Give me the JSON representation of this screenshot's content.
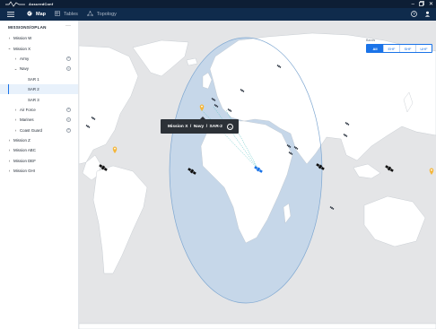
{
  "app": {
    "title": "AssuredConf"
  },
  "nav": {
    "tabs": [
      {
        "label": "Map",
        "icon": "globe-icon",
        "active": true
      },
      {
        "label": "Tables",
        "icon": "table-icon",
        "active": false
      },
      {
        "label": "Topology",
        "icon": "topology-icon",
        "active": false
      }
    ]
  },
  "sidebar": {
    "header": "MISSIONS/OPLAN",
    "more": "···",
    "items": [
      {
        "label": "Mission W",
        "level": 0,
        "chevron": "right"
      },
      {
        "label": "Mission X",
        "level": 0,
        "chevron": "down"
      },
      {
        "label": "Army",
        "level": 1,
        "chevron": "right",
        "plus": true
      },
      {
        "label": "Navy",
        "level": 1,
        "chevron": "down",
        "plus": true
      },
      {
        "label": "SAR 1",
        "level": 2
      },
      {
        "label": "SAR 2",
        "level": 2,
        "selected": true
      },
      {
        "label": "SAR 3",
        "level": 2
      },
      {
        "label": "Air Force",
        "level": 1,
        "chevron": "right",
        "plus": true
      },
      {
        "label": "Marines",
        "level": 1,
        "chevron": "right",
        "plus": true
      },
      {
        "label": "Coast Guard",
        "level": 1,
        "chevron": "right",
        "plus": true
      },
      {
        "label": "Mission Z",
        "level": 0,
        "chevron": "right"
      },
      {
        "label": "Mission ABC",
        "level": 0,
        "chevron": "right"
      },
      {
        "label": "Mission DEF",
        "level": 0,
        "chevron": "right"
      },
      {
        "label": "Mission GHI",
        "level": 0,
        "chevron": "right"
      }
    ]
  },
  "bands": {
    "label": "Bands",
    "options": [
      {
        "label": "All",
        "active": true
      },
      {
        "label": "EHF",
        "active": false
      },
      {
        "label": "SHF",
        "active": false
      },
      {
        "label": "UHF",
        "active": false
      }
    ]
  },
  "tooltip": {
    "mission": "Mission X",
    "branch": "Navy",
    "unit": "SAR-2",
    "separator": "/"
  },
  "colors": {
    "accent": "#1a73e8",
    "titlebar": "#0d1e35",
    "navbar": "#0f2b4c",
    "coverage": "#c3d6ea",
    "marker": "#f4b63a",
    "satellite": "#111111"
  }
}
